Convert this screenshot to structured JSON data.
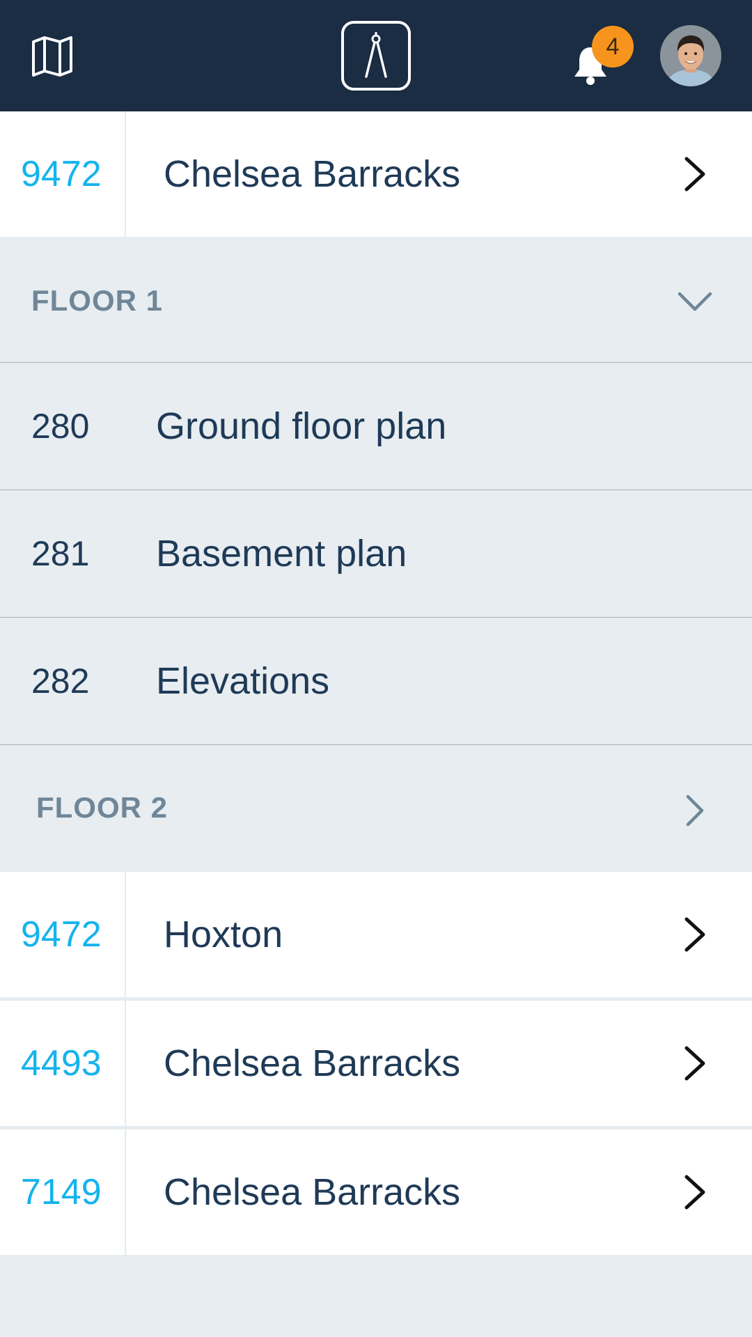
{
  "header": {
    "notification_count": "4",
    "icons": {
      "map": "map-icon",
      "logo": "compass-icon",
      "bell": "bell-icon",
      "avatar": "user-avatar"
    },
    "colors": {
      "background": "#1a2d43",
      "badge": "#f7941d"
    }
  },
  "projects_top": [
    {
      "number": "9472",
      "name": "Chelsea Barracks"
    }
  ],
  "floors": [
    {
      "title": "FLOOR 1",
      "expanded": true,
      "plans": [
        {
          "number": "280",
          "name": "Ground floor plan"
        },
        {
          "number": "281",
          "name": "Basement plan"
        },
        {
          "number": "282",
          "name": "Elevations"
        }
      ]
    },
    {
      "title": "FLOOR 2",
      "expanded": false,
      "plans": []
    }
  ],
  "projects_bottom": [
    {
      "number": "9472",
      "name": "Hoxton"
    },
    {
      "number": "4493",
      "name": "Chelsea Barracks"
    },
    {
      "number": "7149",
      "name": "Chelsea Barracks"
    }
  ],
  "colors": {
    "accent": "#15b3ee",
    "text": "#1f3a57",
    "muted": "#6f8698",
    "page_bg": "#e7edf0"
  }
}
